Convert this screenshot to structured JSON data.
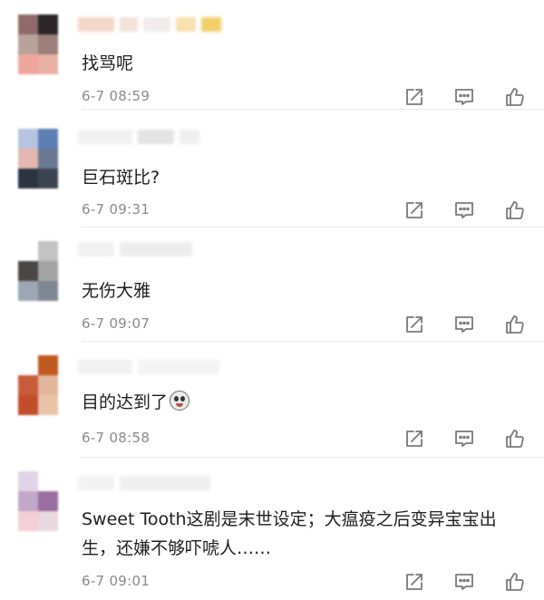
{
  "comments": [
    {
      "text": "找骂呢",
      "time": "6-7 08:59",
      "avatar_colors": [
        "#8f6a6a",
        "#2c2626",
        "#b9a29a",
        "#9a7f7a",
        "#f0a79b",
        "#e8b0a3"
      ],
      "name_blocks": [
        {
          "color": "#f3d7c8"
        },
        {
          "color": "#f3e2d6"
        },
        {
          "color": "#f2ecec"
        },
        {
          "color": "#f7e1b0"
        },
        {
          "color": "#f0cf6a"
        }
      ]
    },
    {
      "text": "巨石斑比?",
      "time": "6-7 09:31",
      "avatar_colors": [
        "#b6c4e2",
        "#5e7fb3",
        "#e4b8b1",
        "#6b7891",
        "#2c3442",
        "#3b4250"
      ],
      "name_blocks": [
        {
          "color": "#f1f1f1"
        },
        {
          "color": "#e4e4e4"
        },
        {
          "color": "#efefef"
        }
      ]
    },
    {
      "text": "无伤大雅",
      "time": "6-7 09:07",
      "avatar_colors": [
        "#ffffff",
        "#c3c3c3",
        "#4a4644",
        "#a4a4a4",
        "#9ca7b5",
        "#7f8794"
      ],
      "name_blocks": [
        {
          "color": "#f2f2f2"
        },
        {
          "color": "#ededed"
        }
      ]
    },
    {
      "text": "目的达到了",
      "emoji": "scared-face",
      "time": "6-7 08:58",
      "avatar_colors": [
        "#ffffff",
        "#c0591e",
        "#c75c3a",
        "#e0b79c",
        "#c24d2a",
        "#e8c3a8"
      ],
      "name_blocks": [
        {
          "color": "#f2f2f2"
        },
        {
          "color": "#f4f4f4"
        }
      ]
    },
    {
      "text": "Sweet Tooth这剧是末世设定；大瘟疫之后变异宝宝出生，还嫌不够吓唬人……",
      "time": "6-7 09:01",
      "avatar_colors": [
        "#e2d4e6",
        "#ffffff",
        "#c2a8c8",
        "#9a6ea0",
        "#f3cfd6",
        "#e9d9de"
      ],
      "name_blocks": [
        {
          "color": "#f3f3f3"
        },
        {
          "color": "#efefef"
        }
      ]
    }
  ],
  "icons": {
    "share": "share-icon",
    "comment": "comment-icon",
    "like": "thumbs-up-icon"
  },
  "colors": {
    "timestamp": "#8a8a8a",
    "icon_stroke": "#7a7a7a",
    "divider": "#e9e9e9"
  }
}
